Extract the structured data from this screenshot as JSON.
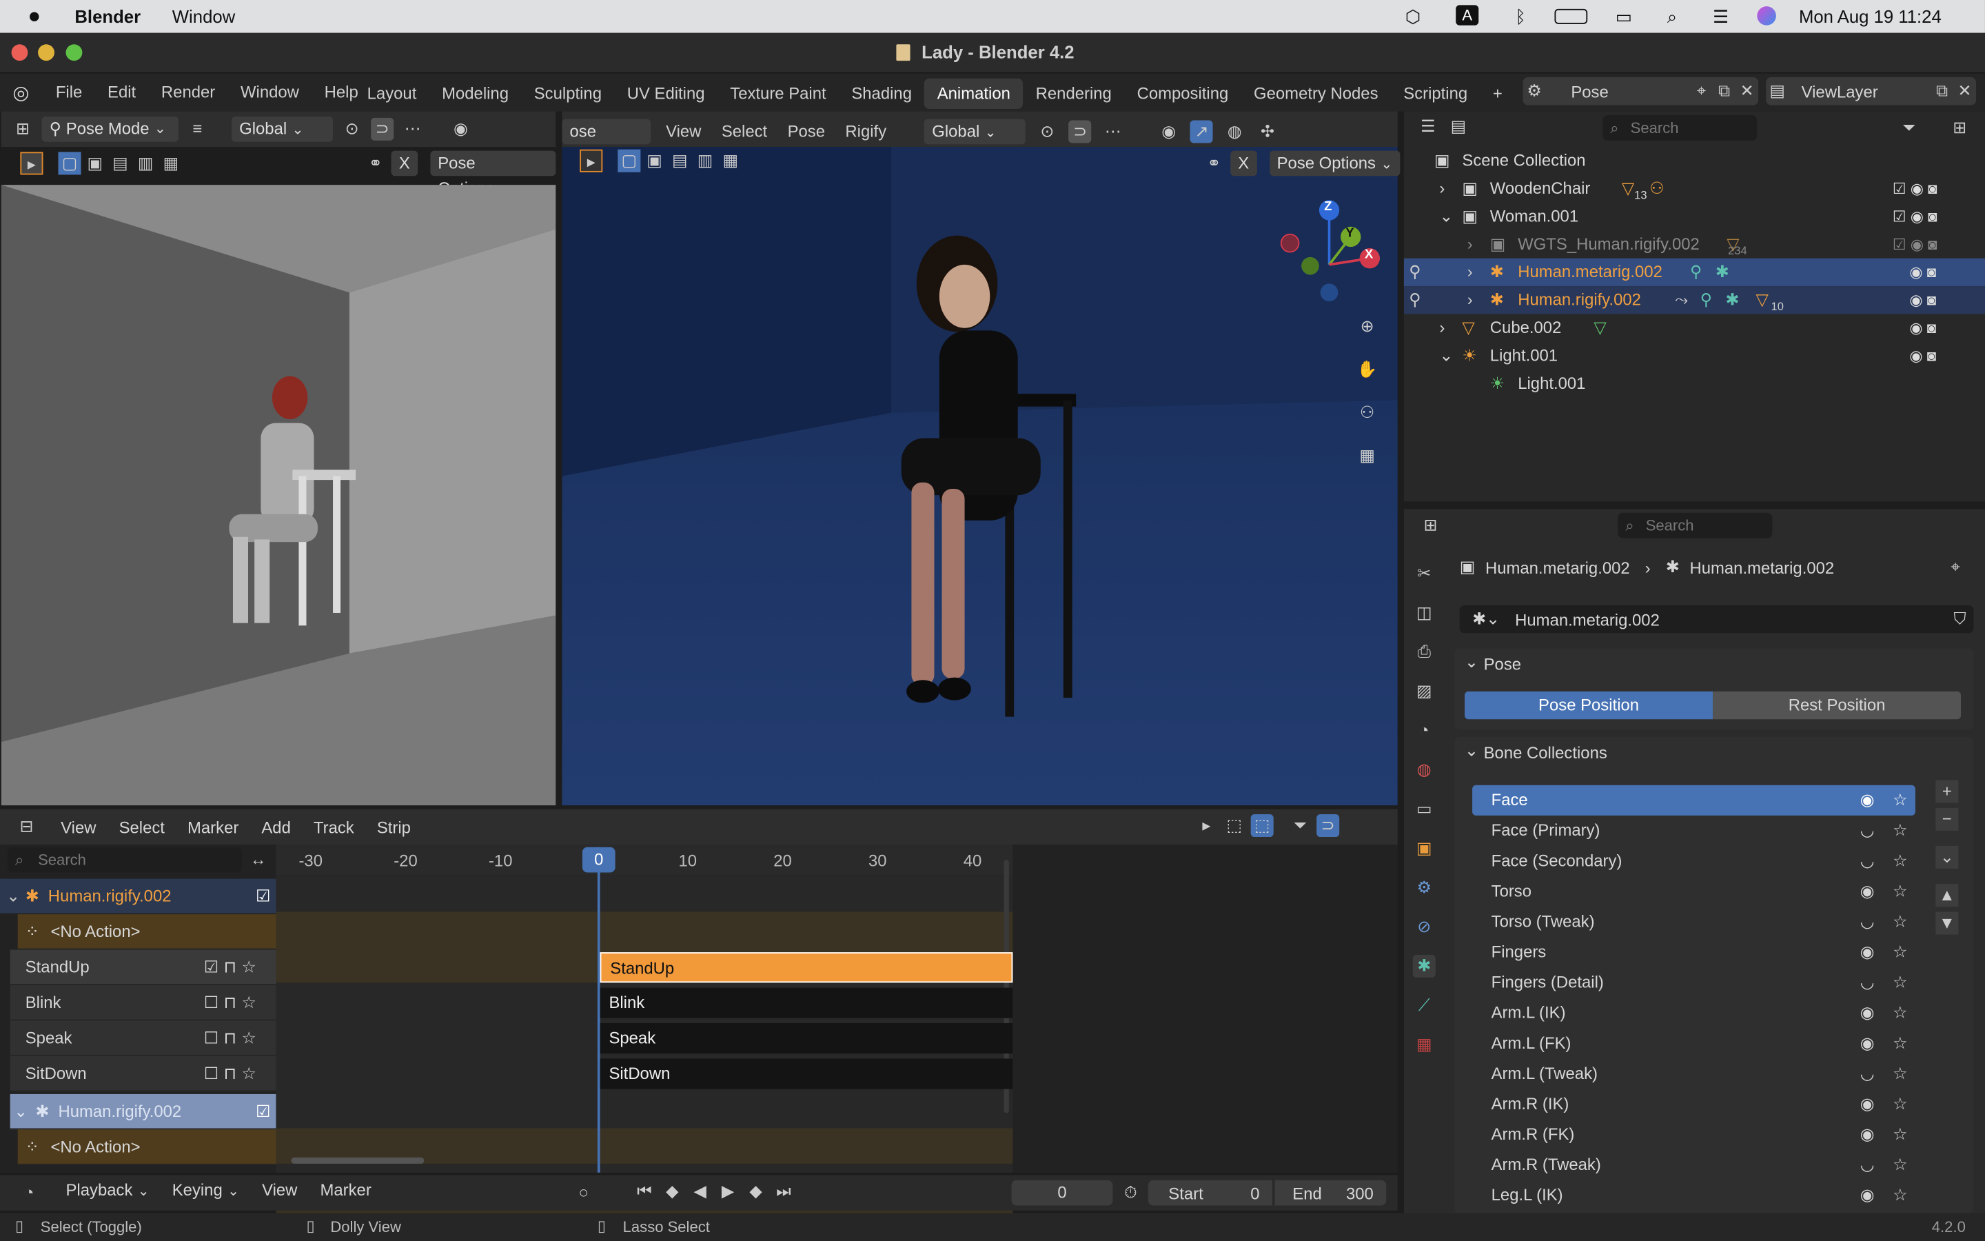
{
  "mac": {
    "app": "Blender",
    "menu": "Window",
    "datetime": "Mon Aug 19  11:24",
    "a_label": "A"
  },
  "window": {
    "title": "Lady - Blender 4.2"
  },
  "menus": [
    "File",
    "Edit",
    "Render",
    "Window",
    "Help"
  ],
  "workspaces": [
    "Layout",
    "Modeling",
    "Sculpting",
    "UV Editing",
    "Texture Paint",
    "Shading",
    "Animation",
    "Rendering",
    "Compositing",
    "Geometry Nodes",
    "Scripting"
  ],
  "scene": {
    "name": "Pose",
    "viewlayer": "ViewLayer"
  },
  "left_view": {
    "mode": "Pose Mode",
    "orientation": "Global",
    "pose_options": "Pose Options",
    "x_label": "X"
  },
  "main_view": {
    "mode": "ose Mode",
    "menus": [
      "View",
      "Select",
      "Pose",
      "Rigify"
    ],
    "orientation": "Global",
    "pose_options": "Pose Options",
    "x_label": "X"
  },
  "gizmo": {
    "z": "Z",
    "y": "Y",
    "x": "X"
  },
  "outliner": {
    "search_placeholder": "Search",
    "rows": [
      {
        "label": "Scene Collection",
        "extra": ""
      },
      {
        "label": "WoodenChair",
        "extra": "13"
      },
      {
        "label": "Woman.001",
        "extra": ""
      },
      {
        "label": "WGTS_Human.rigify.002",
        "extra": "234"
      },
      {
        "label": "Human.metarig.002",
        "extra": ""
      },
      {
        "label": "Human.rigify.002",
        "extra": "10"
      },
      {
        "label": "Cube.002",
        "extra": ""
      },
      {
        "label": "Light.001",
        "extra": ""
      },
      {
        "label": "Light.001",
        "extra": ""
      }
    ]
  },
  "properties": {
    "search_placeholder": "Search",
    "crumb1": "Human.metarig.002",
    "crumb2": "Human.metarig.002",
    "data_name": "Human.metarig.002",
    "pose_panel": "Pose",
    "pose_position": "Pose Position",
    "rest_position": "Rest Position",
    "bone_collections": "Bone Collections",
    "collections": [
      {
        "name": "Face",
        "visible": true
      },
      {
        "name": "Face (Primary)",
        "visible": false
      },
      {
        "name": "Face (Secondary)",
        "visible": false
      },
      {
        "name": "Torso",
        "visible": true
      },
      {
        "name": "Torso (Tweak)",
        "visible": false
      },
      {
        "name": "Fingers",
        "visible": true
      },
      {
        "name": "Fingers (Detail)",
        "visible": false
      },
      {
        "name": "Arm.L (IK)",
        "visible": true
      },
      {
        "name": "Arm.L (FK)",
        "visible": true
      },
      {
        "name": "Arm.L (Tweak)",
        "visible": false
      },
      {
        "name": "Arm.R (IK)",
        "visible": true
      },
      {
        "name": "Arm.R (FK)",
        "visible": true
      },
      {
        "name": "Arm.R (Tweak)",
        "visible": false
      },
      {
        "name": "Leg.L (IK)",
        "visible": true
      }
    ]
  },
  "nla": {
    "menus": [
      "View",
      "Select",
      "Marker",
      "Add",
      "Track",
      "Strip"
    ],
    "search_placeholder": "Search",
    "ruler": [
      "-30",
      "-20",
      "-10",
      "0",
      "10",
      "20",
      "30",
      "40"
    ],
    "rig1": "Human.rigify.002",
    "no_action": "<No Action>",
    "tracks": [
      "StandUp",
      "Blink",
      "Speak",
      "SitDown"
    ],
    "rig2": "Human.rigify.002",
    "no_action2": "<No Action>"
  },
  "timeline": {
    "playback": "Playback",
    "keying": "Keying",
    "view": "View",
    "marker": "Marker",
    "current": "0",
    "start_label": "Start",
    "start": "0",
    "end_label": "End",
    "end": "300"
  },
  "status": {
    "select": "Select (Toggle)",
    "dolly": "Dolly View",
    "lasso": "Lasso Select",
    "version": "4.2.0"
  }
}
